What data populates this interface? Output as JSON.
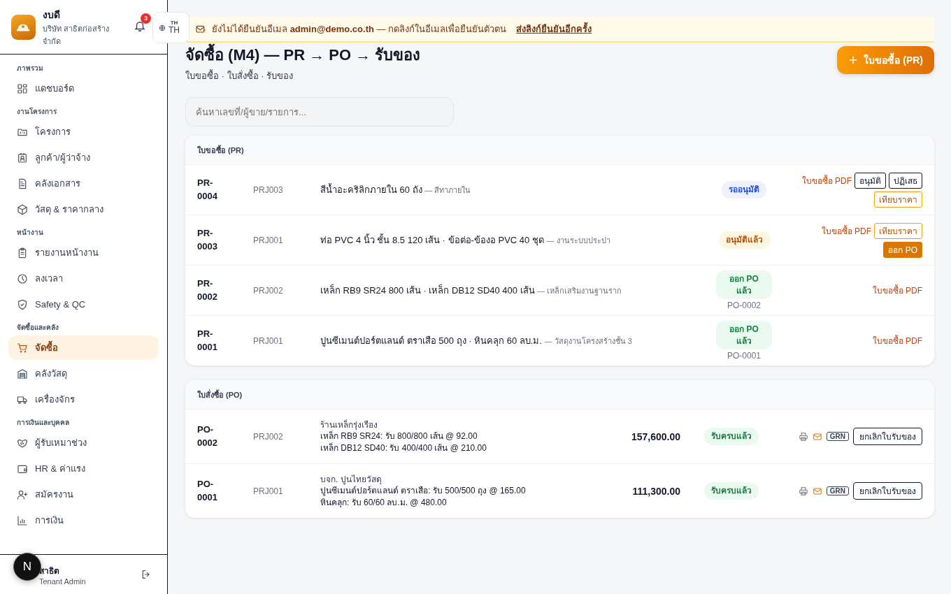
{
  "brand": {
    "name": "งบดี",
    "company": "บริษัท สาธิตก่อสร้าง จำกัด"
  },
  "notifications": {
    "count": "3"
  },
  "language": {
    "small": "TH",
    "label": "TH"
  },
  "sidebar": {
    "sections": [
      {
        "title": "ภาพรวม",
        "items": [
          {
            "label": "แดชบอร์ด",
            "selected": false
          }
        ]
      },
      {
        "title": "งานโครงการ",
        "items": [
          {
            "label": "โครงการ",
            "selected": false
          },
          {
            "label": "ลูกค้า/ผู้ว่าจ้าง",
            "selected": false
          },
          {
            "label": "คลังเอกสาร",
            "selected": false
          },
          {
            "label": "วัสดุ & ราคากลาง",
            "selected": false
          }
        ]
      },
      {
        "title": "หน้างาน",
        "items": [
          {
            "label": "รายงานหน้างาน",
            "selected": false
          },
          {
            "label": "ลงเวลา",
            "selected": false
          },
          {
            "label": "Safety & QC",
            "selected": false
          }
        ]
      },
      {
        "title": "จัดซื้อและคลัง",
        "items": [
          {
            "label": "จัดซื้อ",
            "selected": true
          },
          {
            "label": "คลังวัสดุ",
            "selected": false
          },
          {
            "label": "เครื่องจักร",
            "selected": false
          }
        ]
      },
      {
        "title": "การเงินและบุคคล",
        "items": [
          {
            "label": "ผู้รับเหมาช่วง",
            "selected": false
          },
          {
            "label": "HR & ค่าแรง",
            "selected": false
          },
          {
            "label": "สมัครงาน",
            "selected": false
          },
          {
            "label": "การเงิน",
            "selected": false
          }
        ]
      }
    ]
  },
  "user": {
    "name": "สาธิต",
    "role": "Tenant Admin",
    "avatar": "N"
  },
  "banner": {
    "text": "ยังไม่ได้ยืนยันอีเมล **admin@demo.co.th** — กดลิงก์ในอีเมลเพื่อยืนยันตัวตน",
    "link": "ส่งลิงก์ยืนยันอีกครั้ง"
  },
  "page": {
    "title": "จัดซื้อ (M4) — PR → PO → รับของ",
    "subtitle": "ใบขอซื้อ · ใบสั่งซื้อ · รับของ",
    "new_button": "ใบขอซื้อ (PR)"
  },
  "search": {
    "placeholder": "ค้นหาเลขที่/ผู้ขาย/รายการ..."
  },
  "pr_table": {
    "title": "ใบขอซื้อ (PR)",
    "rows": [
      {
        "id": "PR-0004",
        "project": "PRJ003",
        "item": "สีน้ำอะคริลิกภายใน 60 ถัง",
        "note": "— สีทาภายใน",
        "status": {
          "label": "รออนุมัติ",
          "kind": "pending"
        },
        "actions": [
          {
            "label": "ใบขอซื้อ PDF",
            "kind": "link"
          },
          {
            "label": "อนุมัติ",
            "kind": "outline"
          },
          {
            "label": "ปฏิเสธ",
            "kind": "outline"
          },
          {
            "label": "เทียบราคา",
            "kind": "quote"
          }
        ]
      },
      {
        "id": "PR-0003",
        "project": "PRJ001",
        "item": "ท่อ PVC 4 นิ้ว ชั้น 8.5 120 เส้น · ข้อต่อ-ข้องอ PVC 40 ชุด",
        "note": "— งานระบบประปา",
        "status": {
          "label": "อนุมัติแล้ว",
          "kind": "approved"
        },
        "actions": [
          {
            "label": "ใบขอซื้อ PDF",
            "kind": "link"
          },
          {
            "label": "เทียบราคา",
            "kind": "quote"
          },
          {
            "label": "ออก PO",
            "kind": "solid"
          }
        ]
      },
      {
        "id": "PR-0002",
        "project": "PRJ002",
        "item": "เหล็ก RB9 SR24 800 เส้น · เหล็ก DB12 SD40 400 เส้น",
        "note": "— เหล็กเสริมงานฐานราก",
        "status": {
          "label": "ออก PO แล้ว",
          "kind": "ordered"
        },
        "po_ref": "PO-0002",
        "actions": [
          {
            "label": "ใบขอซื้อ PDF",
            "kind": "link"
          }
        ]
      },
      {
        "id": "PR-0001",
        "project": "PRJ001",
        "item": "ปูนซีเมนต์ปอร์ตแลนด์ ตราเสือ 500 ถุง · หินคลุก 60 ลบ.ม.",
        "note": "— วัสดุงานโครงสร้างชั้น 3",
        "status": {
          "label": "ออก PO แล้ว",
          "kind": "ordered"
        },
        "po_ref": "PO-0001",
        "actions": [
          {
            "label": "ใบขอซื้อ PDF",
            "kind": "link"
          }
        ]
      }
    ]
  },
  "po_table": {
    "title": "ใบสั่งซื้อ (PO)",
    "rows": [
      {
        "id": "PO-0002",
        "project": "PRJ002",
        "vendor": "ร้านเหล็กรุ่งเรือง",
        "lines": [
          "เหล็ก RB9 SR24: รับ 800/800 เส้น @ 92.00",
          "เหล็ก DB12 SD40: รับ 400/400 เส้น @ 210.00"
        ],
        "amount": "157,600.00",
        "status": {
          "label": "รับครบแล้ว",
          "kind": "received"
        },
        "grn": "GRN",
        "cancel": "ยกเลิกใบรับของ"
      },
      {
        "id": "PO-0001",
        "project": "PRJ001",
        "vendor": "บจก. ปูนไทยวัสดุ",
        "lines": [
          "ปูนซีเมนต์ปอร์ตแลนด์ ตราเสือ: รับ 500/500 ถุง @ 165.00",
          "หินคลุก: รับ 60/60 ลบ.ม. @ 480.00"
        ],
        "amount": "111,300.00",
        "status": {
          "label": "รับครบแล้ว",
          "kind": "received"
        },
        "grn": "GRN",
        "cancel": "ยกเลิกใบรับของ"
      }
    ]
  }
}
